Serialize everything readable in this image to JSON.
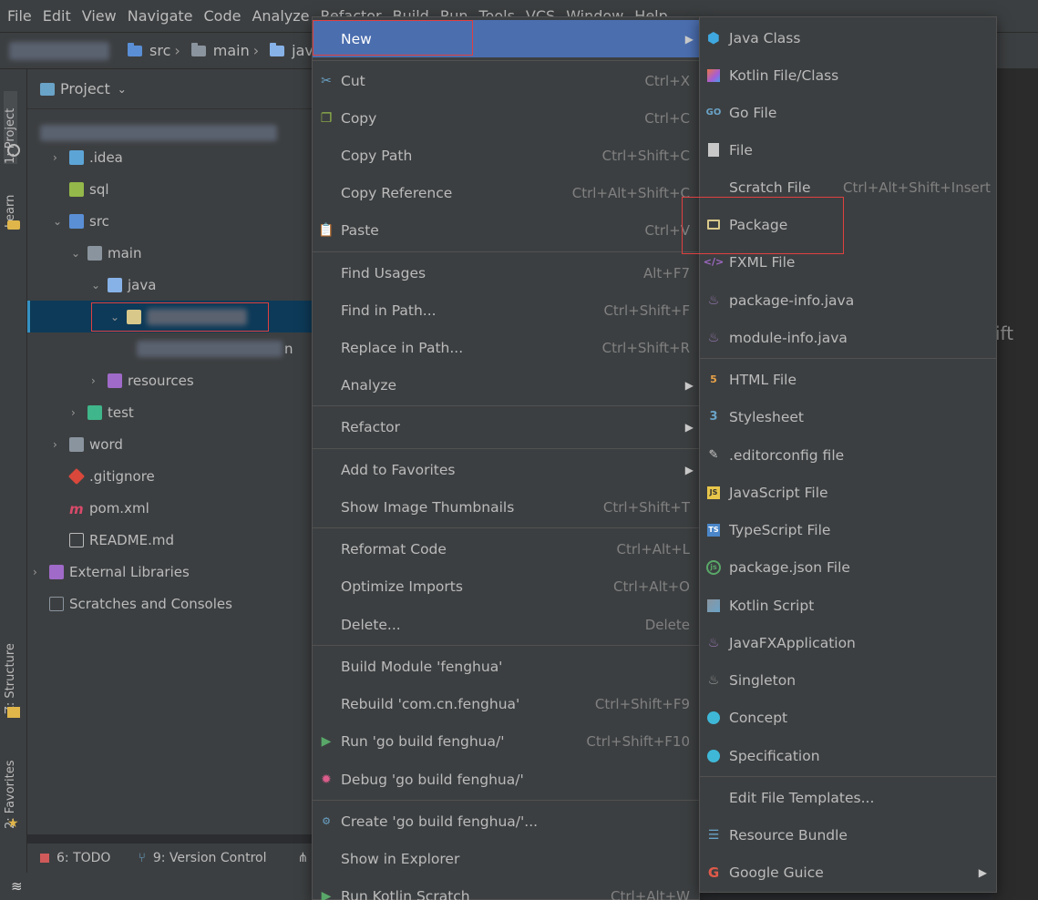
{
  "menubar": {
    "items": [
      "File",
      "Edit",
      "View",
      "Navigate",
      "Code",
      "Analyze",
      "Refactor",
      "Build",
      "Run",
      "Tools",
      "VCS",
      "Window",
      "Help"
    ]
  },
  "navbar": {
    "crumbs": [
      "src",
      "main",
      "java"
    ]
  },
  "project": {
    "header": "Project",
    "tree": [
      {
        "label": ".idea",
        "icon": "folder-icon"
      },
      {
        "label": "sql",
        "icon": "folder-icon"
      },
      {
        "label": "src",
        "icon": "folder-icon"
      },
      {
        "label": "main",
        "icon": "folder-icon"
      },
      {
        "label": "java",
        "icon": "folder-icon"
      },
      {
        "label": "",
        "icon": "package-icon"
      },
      {
        "label": "n",
        "icon": "class-icon"
      },
      {
        "label": "resources",
        "icon": "folder-icon"
      },
      {
        "label": "test",
        "icon": "folder-icon"
      },
      {
        "label": "word",
        "icon": "folder-icon"
      },
      {
        "label": ".gitignore",
        "icon": "git-icon"
      },
      {
        "label": "pom.xml",
        "icon": "maven-icon"
      },
      {
        "label": "README.md",
        "icon": "markdown-icon"
      },
      {
        "label": "External Libraries",
        "icon": "library-icon"
      },
      {
        "label": "Scratches and Consoles",
        "icon": "scratches-icon"
      }
    ]
  },
  "left_strip": {
    "project_tab": "1: Project",
    "learn_tab": "Learn",
    "structure_tab": "Z: Structure",
    "favorites_tab": "2: Favorites"
  },
  "bottom": {
    "todo": "6: TODO",
    "vcs": "9: Version Control"
  },
  "editor": {
    "partial_text": "ift"
  },
  "context_menu": {
    "items": [
      {
        "label": "New",
        "shortcut": "",
        "submenu": true
      },
      {
        "label": "Cut",
        "shortcut": "Ctrl+X"
      },
      {
        "label": "Copy",
        "shortcut": "Ctrl+C"
      },
      {
        "label": "Copy Path",
        "shortcut": "Ctrl+Shift+C"
      },
      {
        "label": "Copy Reference",
        "shortcut": "Ctrl+Alt+Shift+C"
      },
      {
        "label": "Paste",
        "shortcut": "Ctrl+V"
      },
      {
        "label": "Find Usages",
        "shortcut": "Alt+F7"
      },
      {
        "label": "Find in Path...",
        "shortcut": "Ctrl+Shift+F"
      },
      {
        "label": "Replace in Path...",
        "shortcut": "Ctrl+Shift+R"
      },
      {
        "label": "Analyze",
        "shortcut": "",
        "submenu": true
      },
      {
        "label": "Refactor",
        "shortcut": "",
        "submenu": true
      },
      {
        "label": "Add to Favorites",
        "shortcut": "",
        "submenu": true
      },
      {
        "label": "Show Image Thumbnails",
        "shortcut": "Ctrl+Shift+T"
      },
      {
        "label": "Reformat Code",
        "shortcut": "Ctrl+Alt+L"
      },
      {
        "label": "Optimize Imports",
        "shortcut": "Ctrl+Alt+O"
      },
      {
        "label": "Delete...",
        "shortcut": "Delete"
      },
      {
        "label": "Build Module 'fenghua'",
        "shortcut": ""
      },
      {
        "label": "Rebuild 'com.cn.fenghua'",
        "shortcut": "Ctrl+Shift+F9"
      },
      {
        "label": "Run 'go build fenghua/'",
        "shortcut": "Ctrl+Shift+F10"
      },
      {
        "label": "Debug 'go build fenghua/'",
        "shortcut": ""
      },
      {
        "label": "Create 'go build fenghua/'...",
        "shortcut": ""
      },
      {
        "label": "Show in Explorer",
        "shortcut": ""
      },
      {
        "label": "Run Kotlin Scratch",
        "shortcut": "Ctrl+Alt+W"
      }
    ]
  },
  "new_submenu": {
    "items": [
      {
        "label": "Java Class",
        "shortcut": ""
      },
      {
        "label": "Kotlin File/Class",
        "shortcut": ""
      },
      {
        "label": "Go File",
        "shortcut": ""
      },
      {
        "label": "File",
        "shortcut": ""
      },
      {
        "label": "Scratch File",
        "shortcut": "Ctrl+Alt+Shift+Insert"
      },
      {
        "label": "Package",
        "shortcut": ""
      },
      {
        "label": "FXML File",
        "shortcut": ""
      },
      {
        "label": "package-info.java",
        "shortcut": ""
      },
      {
        "label": "module-info.java",
        "shortcut": ""
      },
      {
        "label": "HTML File",
        "shortcut": ""
      },
      {
        "label": "Stylesheet",
        "shortcut": ""
      },
      {
        "label": ".editorconfig file",
        "shortcut": ""
      },
      {
        "label": "JavaScript File",
        "shortcut": ""
      },
      {
        "label": "TypeScript File",
        "shortcut": ""
      },
      {
        "label": "package.json File",
        "shortcut": ""
      },
      {
        "label": "Kotlin Script",
        "shortcut": ""
      },
      {
        "label": "JavaFXApplication",
        "shortcut": ""
      },
      {
        "label": "Singleton",
        "shortcut": ""
      },
      {
        "label": "Concept",
        "shortcut": ""
      },
      {
        "label": "Specification",
        "shortcut": ""
      },
      {
        "label": "Edit File Templates...",
        "shortcut": ""
      },
      {
        "label": "Resource Bundle",
        "shortcut": ""
      },
      {
        "label": "Google Guice",
        "shortcut": ""
      }
    ]
  },
  "colors": {
    "highlight": "#4b6eaf",
    "annotation_red": "#e04040",
    "folder_blue": "#87b2e8",
    "folder_source": "#5a8fd6",
    "folder_test": "#3fb68b"
  }
}
